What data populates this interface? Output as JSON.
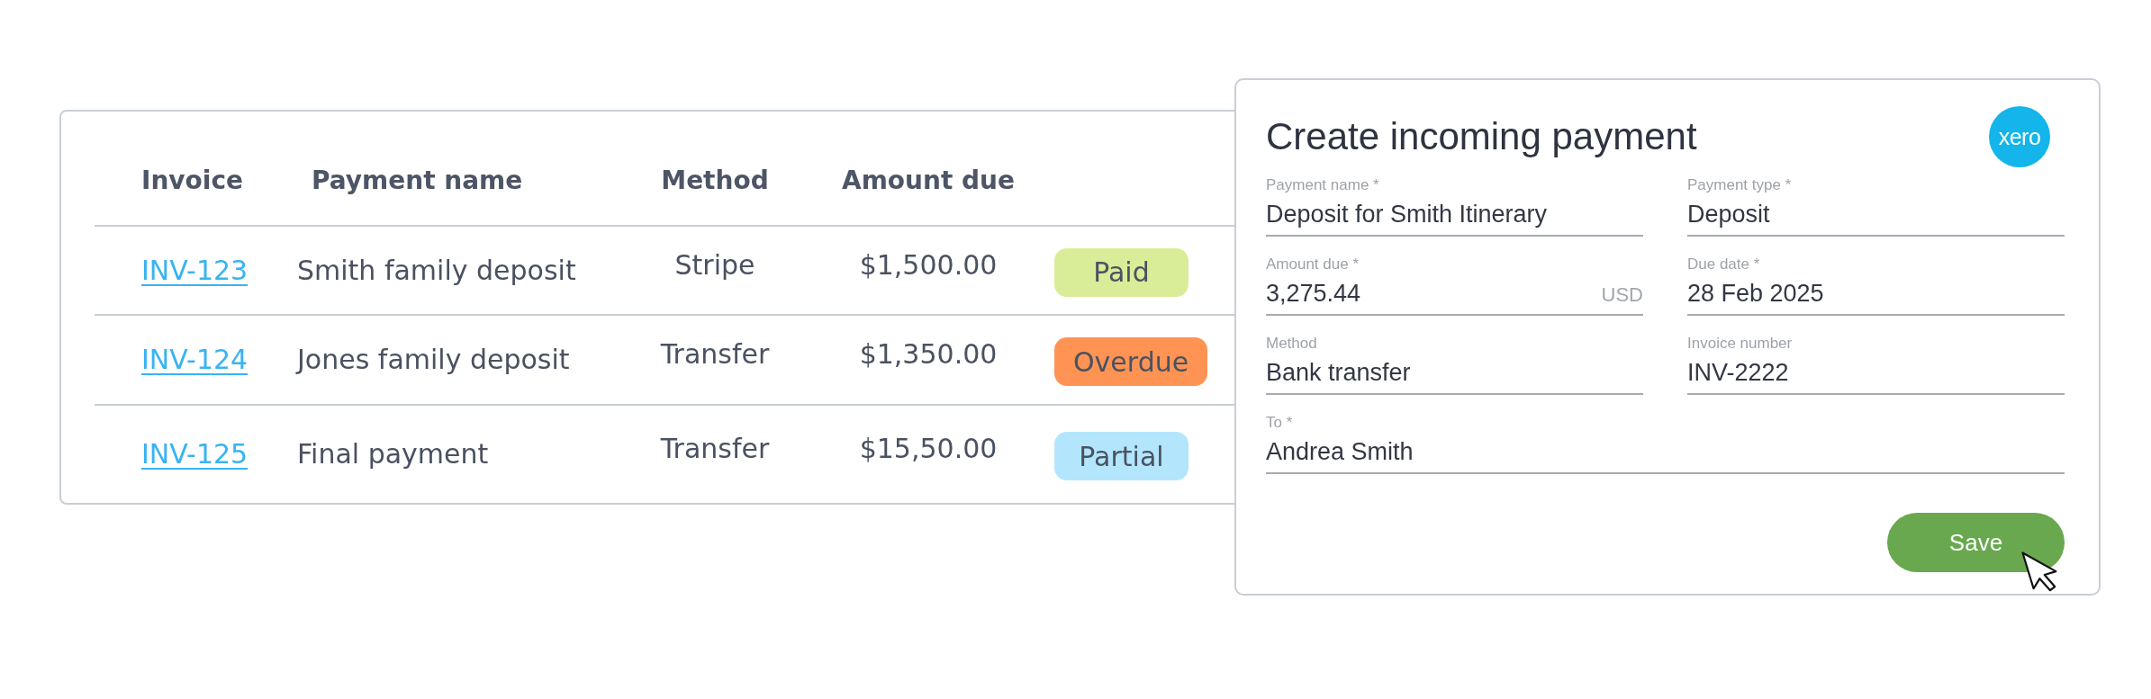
{
  "table": {
    "columns": [
      "Invoice",
      "Payment name",
      "Method",
      "Amount due"
    ],
    "rows": [
      {
        "invoice": "INV-123",
        "payment_name": "Smith family deposit",
        "method": "Stripe",
        "amount_due": "$1,500.00",
        "status": {
          "label": "Paid",
          "color": "#d9ed98"
        }
      },
      {
        "invoice": "INV-124",
        "payment_name": "Jones family deposit",
        "method": "Transfer",
        "amount_due": "$1,350.00",
        "status": {
          "label": "Overdue",
          "color": "#fe9354"
        }
      },
      {
        "invoice": "INV-125",
        "payment_name": "Final payment",
        "method": "Transfer",
        "amount_due": "$15,50.00",
        "status": {
          "label": "Partial",
          "color": "#b3e6fc"
        }
      }
    ]
  },
  "dialog": {
    "title": "Create incoming payment",
    "logo": "xero",
    "fields": [
      {
        "kind": "half",
        "label": "Payment name *",
        "value": "Deposit for Smith Itinerary"
      },
      {
        "kind": "half",
        "label": "Payment type *",
        "value": "Deposit"
      },
      {
        "kind": "half",
        "label": "Amount due *",
        "value": "3,275.44",
        "suffix": "USD"
      },
      {
        "kind": "half",
        "label": "Due date *",
        "value": "28 Feb 2025"
      },
      {
        "kind": "half",
        "label": "Method",
        "value": "Bank transfer"
      },
      {
        "kind": "half",
        "label": "Invoice number",
        "value": "INV-2222"
      },
      {
        "kind": "full",
        "label": "To *",
        "value": "Andrea Smith"
      }
    ],
    "buttons": [
      "Save"
    ]
  }
}
